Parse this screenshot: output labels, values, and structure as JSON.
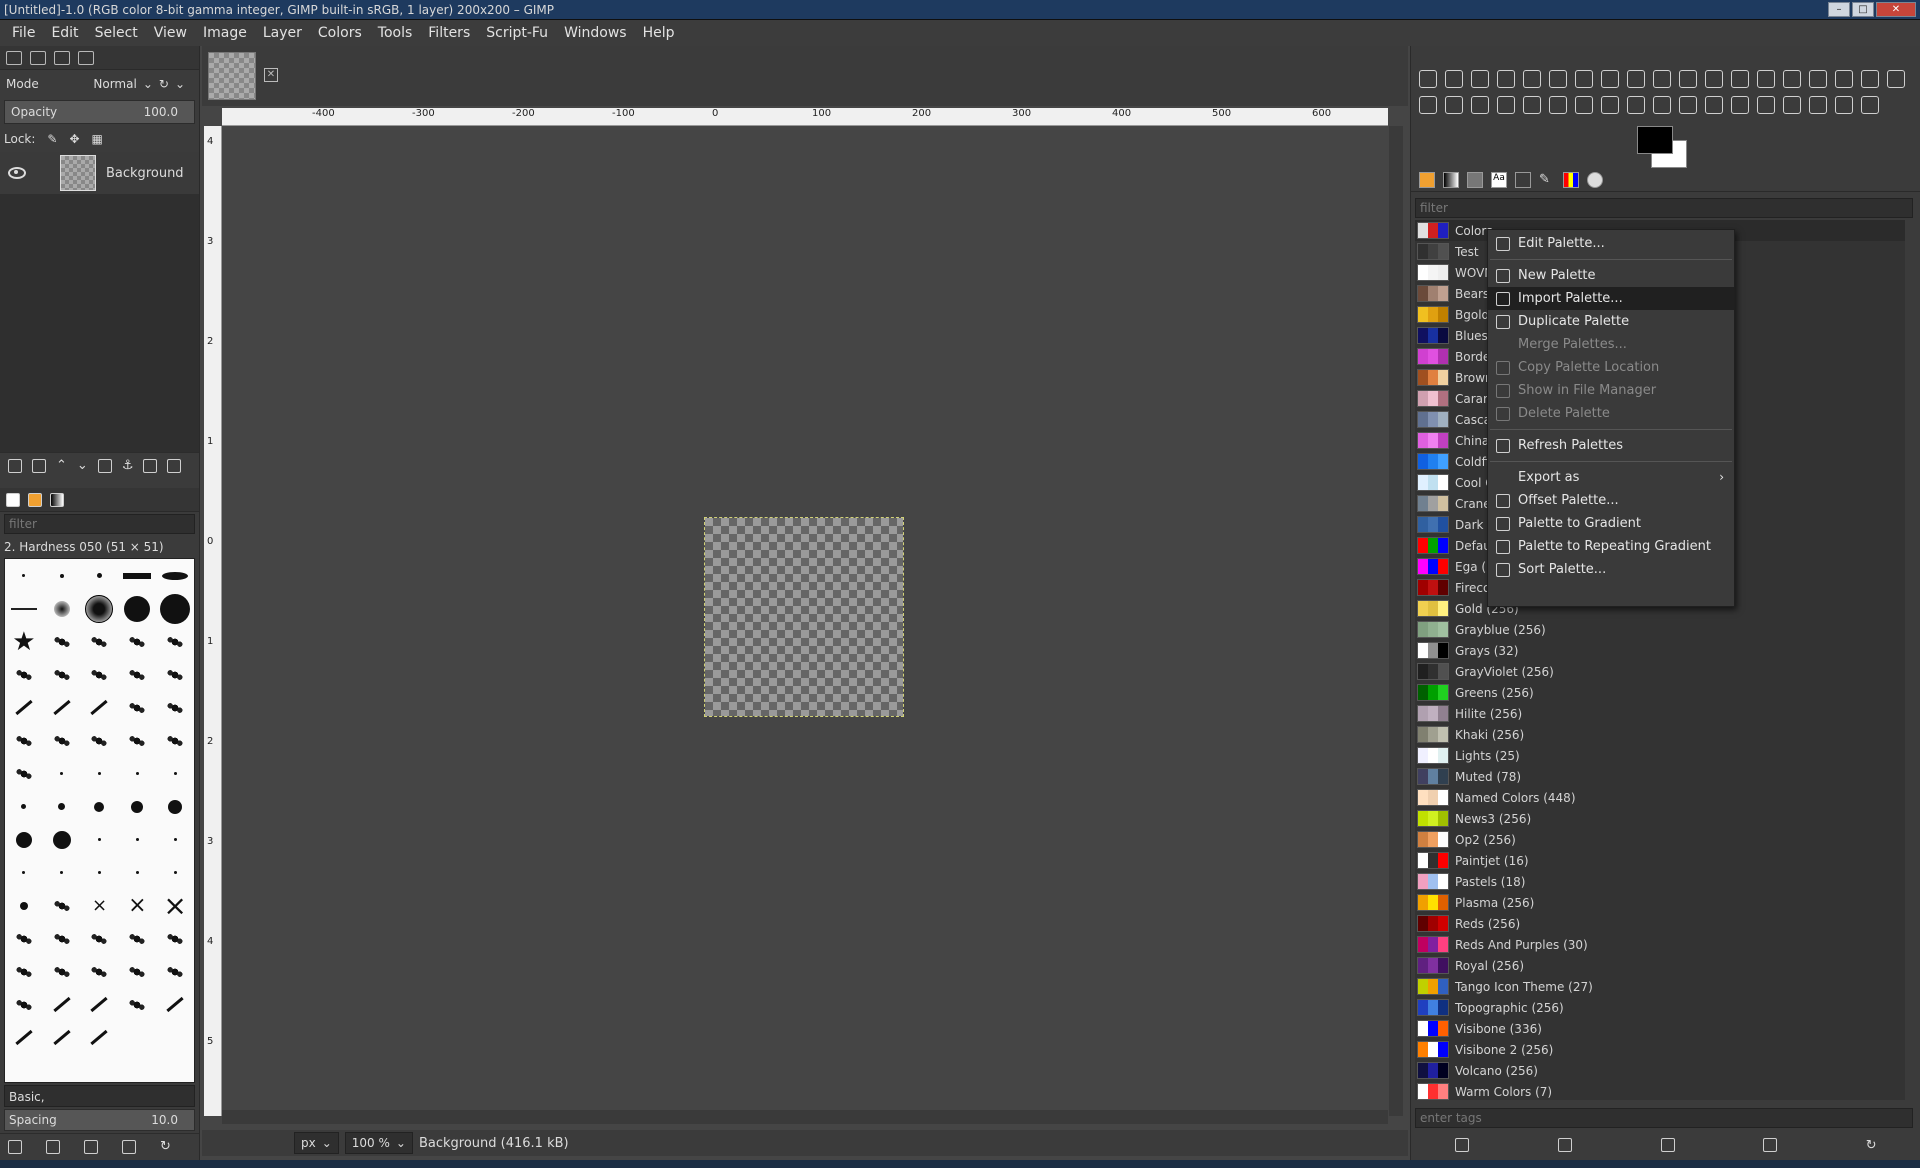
{
  "window": {
    "title": "[Untitled]-1.0 (RGB color 8-bit gamma integer, GIMP built-in sRGB, 1 layer) 200x200 – GIMP"
  },
  "menubar": [
    "File",
    "Edit",
    "Select",
    "View",
    "Image",
    "Layer",
    "Colors",
    "Tools",
    "Filters",
    "Script-Fu",
    "Windows",
    "Help"
  ],
  "layers": {
    "mode_label": "Mode",
    "mode_value": "Normal",
    "opacity_label": "Opacity",
    "opacity_value": "100.0",
    "lock_label": "Lock:",
    "layer_name": "Background"
  },
  "brushes": {
    "filter_placeholder": "filter",
    "current_brush": "2. Hardness 050 (51 × 51)",
    "preset": "Basic,",
    "spacing_label": "Spacing",
    "spacing_value": "10.0"
  },
  "rulers": {
    "horizontal": [
      "-400",
      "-300",
      "-200",
      "-100",
      "0",
      "100",
      "200",
      "300",
      "400",
      "500",
      "600"
    ],
    "vertical": [
      "4",
      "3",
      "2",
      "1",
      "0",
      "1",
      "2",
      "3",
      "4",
      "5"
    ]
  },
  "statusbar": {
    "unit": "px",
    "zoom": "100 %",
    "info": "Background (416.1 kB)"
  },
  "palettes": {
    "filter_placeholder": "filter",
    "tags_placeholder": "enter tags",
    "items": [
      {
        "name": "Colors",
        "colors": [
          "#e0e0e0",
          "#d02020",
          "#2020c0"
        ]
      },
      {
        "name": "Test",
        "colors": [
          "#303030",
          "#404040",
          "#505050"
        ]
      },
      {
        "name": "WOVN",
        "colors": [
          "#ffffff",
          "#f4f4f4",
          "#eeeeee"
        ]
      },
      {
        "name": "Bears",
        "colors": [
          "#6b4a3a",
          "#a08070",
          "#c0a090"
        ]
      },
      {
        "name": "Bgold",
        "colors": [
          "#f0c020",
          "#e0a010",
          "#c08000"
        ]
      },
      {
        "name": "Blues",
        "colors": [
          "#101060",
          "#1830a0",
          "#0a0a40"
        ]
      },
      {
        "name": "Borders",
        "colors": [
          "#d040d0",
          "#e050e0",
          "#b030b0"
        ]
      },
      {
        "name": "Browns",
        "colors": [
          "#a05020",
          "#e08040",
          "#f0d0a0"
        ]
      },
      {
        "name": "Caramel",
        "colors": [
          "#d0a0b0",
          "#f0c0d0",
          "#b07080"
        ]
      },
      {
        "name": "Cascade",
        "colors": [
          "#607090",
          "#8090b0",
          "#a0b0c0"
        ]
      },
      {
        "name": "China",
        "colors": [
          "#e060e0",
          "#f080f0",
          "#c040c0"
        ]
      },
      {
        "name": "Coldfire",
        "colors": [
          "#1060e0",
          "#2080f0",
          "#40a0ff"
        ]
      },
      {
        "name": "Cool Colors",
        "colors": [
          "#e0f0ff",
          "#c0e0f0",
          "#ffffff"
        ]
      },
      {
        "name": "Cranes",
        "colors": [
          "#708090",
          "#a0a0a0",
          "#d0c0a0"
        ]
      },
      {
        "name": "Dark Pastels",
        "colors": [
          "#3060a0",
          "#4070b0",
          "#2050a0"
        ]
      },
      {
        "name": "Default",
        "colors": [
          "#ff0000",
          "#00a000",
          "#0000ff"
        ]
      },
      {
        "name": "Ega (16)",
        "colors": [
          "#ff00ff",
          "#0000ff",
          "#ff0000"
        ]
      },
      {
        "name": "Firecode",
        "colors": [
          "#a00000",
          "#c01010",
          "#600000"
        ]
      },
      {
        "name": "Gold (256)",
        "colors": [
          "#f0d050",
          "#e0c040",
          "#fff080"
        ]
      },
      {
        "name": "Grayblue (256)",
        "colors": [
          "#80a080",
          "#90b090",
          "#a0c0a0"
        ]
      },
      {
        "name": "Grays (32)",
        "colors": [
          "#ffffff",
          "#909090",
          "#000000"
        ]
      },
      {
        "name": "GrayViolet (256)",
        "colors": [
          "#202020",
          "#303030",
          "#505050"
        ]
      },
      {
        "name": "Greens (256)",
        "colors": [
          "#006000",
          "#00a000",
          "#20d020"
        ]
      },
      {
        "name": "Hilite (256)",
        "colors": [
          "#b0a0b0",
          "#c0b0c0",
          "#908090"
        ]
      },
      {
        "name": "Khaki (256)",
        "colors": [
          "#808070",
          "#a0a090",
          "#c0c0b0"
        ]
      },
      {
        "name": "Lights (25)",
        "colors": [
          "#f0f0ff",
          "#ffffff",
          "#e0f0f0"
        ]
      },
      {
        "name": "Muted (78)",
        "colors": [
          "#404060",
          "#6080a0",
          "#304050"
        ]
      },
      {
        "name": "Named Colors (448)",
        "colors": [
          "#ffe0c0",
          "#f0d0b0",
          "#ffffff"
        ]
      },
      {
        "name": "News3 (256)",
        "colors": [
          "#c0e000",
          "#d0f020",
          "#a0c000"
        ]
      },
      {
        "name": "Op2 (256)",
        "colors": [
          "#d08040",
          "#f0a060",
          "#ffffff"
        ]
      },
      {
        "name": "Paintjet (16)",
        "colors": [
          "#ffffff",
          "#303030",
          "#ff0000"
        ]
      },
      {
        "name": "Pastels (18)",
        "colors": [
          "#f0a0c0",
          "#a0c0f0",
          "#ffffff"
        ]
      },
      {
        "name": "Plasma (256)",
        "colors": [
          "#f0a000",
          "#ffe000",
          "#e06000"
        ]
      },
      {
        "name": "Reds (256)",
        "colors": [
          "#600000",
          "#a00000",
          "#d00000"
        ]
      },
      {
        "name": "Reds And Purples (30)",
        "colors": [
          "#c00060",
          "#8020a0",
          "#ff4080"
        ]
      },
      {
        "name": "Royal (256)",
        "colors": [
          "#602080",
          "#8030a0",
          "#401060"
        ]
      },
      {
        "name": "Tango Icon Theme (27)",
        "colors": [
          "#c0d000",
          "#f0a000",
          "#3060c0"
        ]
      },
      {
        "name": "Topographic (256)",
        "colors": [
          "#2040c0",
          "#4080e0",
          "#103080"
        ]
      },
      {
        "name": "Visibone (336)",
        "colors": [
          "#ffffff",
          "#0000ff",
          "#ff6000"
        ]
      },
      {
        "name": "Visibone 2 (256)",
        "colors": [
          "#ff8000",
          "#ffffff",
          "#0000ff"
        ]
      },
      {
        "name": "Volcano (256)",
        "colors": [
          "#101040",
          "#2020a0",
          "#000020"
        ]
      },
      {
        "name": "Warm Colors (7)",
        "colors": [
          "#ffffff",
          "#ff3030",
          "#ff8080"
        ]
      }
    ]
  },
  "context_menu": {
    "items": [
      {
        "label": "Edit Palette...",
        "icon": "edit-icon",
        "disabled": false
      },
      {
        "sep": true
      },
      {
        "label": "New Palette",
        "icon": "new-palette-icon",
        "disabled": false
      },
      {
        "label": "Import Palette...",
        "icon": "import-icon",
        "disabled": false,
        "highlighted": true
      },
      {
        "label": "Duplicate Palette",
        "icon": "duplicate-icon",
        "disabled": false
      },
      {
        "label": "Merge Palettes...",
        "icon": "",
        "disabled": true
      },
      {
        "label": "Copy Palette Location",
        "icon": "copy-location-icon",
        "disabled": true
      },
      {
        "label": "Show in File Manager",
        "icon": "file-manager-icon",
        "disabled": true
      },
      {
        "label": "Delete Palette",
        "icon": "delete-icon",
        "disabled": true
      },
      {
        "sep": true
      },
      {
        "label": "Refresh Palettes",
        "icon": "refresh-icon",
        "disabled": false
      },
      {
        "sep": true
      },
      {
        "label": "Export as",
        "icon": "",
        "disabled": false,
        "submenu": true
      },
      {
        "label": "Offset Palette...",
        "icon": "script-icon",
        "disabled": false
      },
      {
        "label": "Palette to Gradient",
        "icon": "script-icon",
        "disabled": false
      },
      {
        "label": "Palette to Repeating Gradient",
        "icon": "script-icon",
        "disabled": false
      },
      {
        "label": "Sort Palette...",
        "icon": "script-icon",
        "disabled": false
      }
    ]
  },
  "colors": {
    "foreground": "#000000",
    "background": "#ffffff",
    "selection_outline": "#d2d278"
  }
}
